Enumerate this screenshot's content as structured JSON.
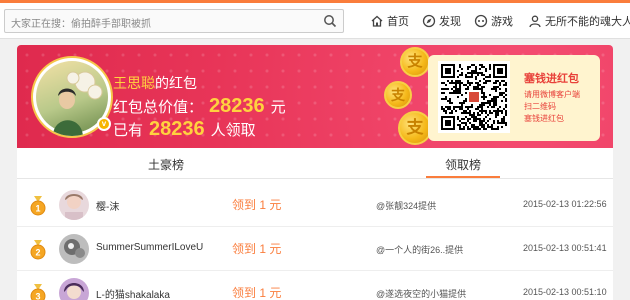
{
  "search": {
    "placeholder": "大家正在搜：偷拍醉手部职被抓"
  },
  "nav": {
    "home": "首页",
    "discover": "发现",
    "game": "游戏",
    "user": "无所不能的魂大人"
  },
  "banner": {
    "owner_name": "王思聪",
    "owner_suffix": "的红包",
    "total_label": "红包总价值：",
    "total_value": "28236",
    "total_unit": "元",
    "claimed_prefix": "已有",
    "claimed_count": "28236",
    "claimed_suffix": "人领取",
    "coin_char": "支",
    "qr_title": "塞钱进红包",
    "qr_lines": [
      "请用微博客户端",
      "扫二维码",
      "塞钱进红包"
    ]
  },
  "tabs": {
    "rich": "土豪榜",
    "claimed": "领取榜"
  },
  "rows": [
    {
      "rank": "1",
      "name": "樱-沫",
      "amount": "领到 1 元",
      "provider": "@张靓324提供",
      "time": "2015-02-13 01:22:56",
      "medal_color": "#f5a623"
    },
    {
      "rank": "2",
      "name": "SummerSummerILoveU",
      "amount": "领到 1 元",
      "provider": "@一个人的街26..提供",
      "time": "2015-02-13 00:51:41",
      "medal_color": "#f5a623"
    },
    {
      "rank": "3",
      "name": "L-的猫shakalaka",
      "amount": "领到 1 元",
      "provider": "@遂选夜空的小猫提供",
      "time": "2015-02-13 00:51:10",
      "medal_color": "#f5a623"
    }
  ]
}
